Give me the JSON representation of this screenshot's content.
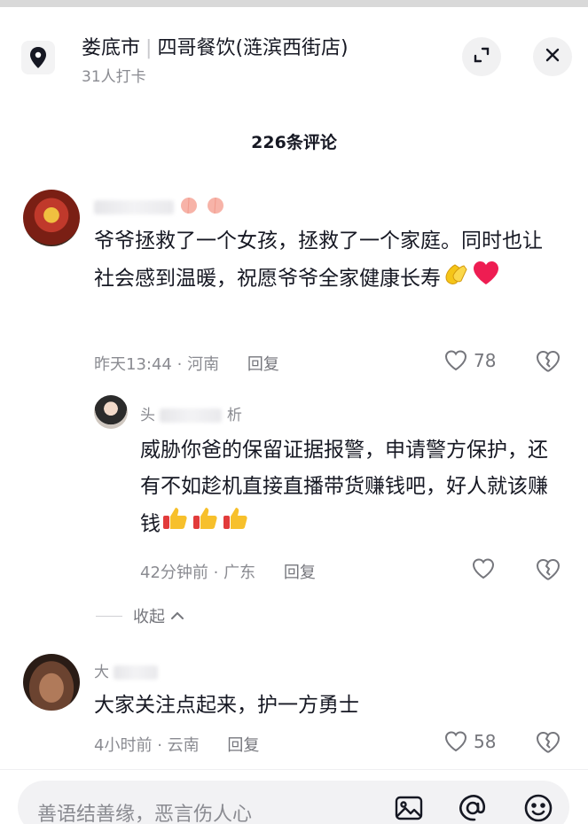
{
  "header": {
    "city": "娄底市",
    "separator": "|",
    "place_name": "四哥餐饮(涟滨西街店)",
    "checkins": "31人打卡",
    "icons": [
      "location-pin-icon",
      "expand-icon",
      "close-icon"
    ]
  },
  "comments_title": "226条评论",
  "comments": [
    {
      "text": "爷爷拯救了一个女孩，拯救了一个家庭。同时也让社会感到温暖，祝愿爷爷全家健康长寿",
      "time": "昨天13:44",
      "dot": "·",
      "region": "河南",
      "reply_label": "回复",
      "likes": "78"
    },
    {
      "username": "头",
      "username_end": "析",
      "text": "威胁你爸的保留证据报警，申请警方保护，还有不如趁机直接直播带货赚钱吧，好人就该赚钱",
      "time": "42分钟前",
      "dot": "·",
      "region": "广东",
      "reply_label": "回复"
    },
    {
      "username": "大",
      "text": "大家关注点起来，护一方勇士",
      "time": "4小时前",
      "dot": "·",
      "region": "云南",
      "reply_label": "回复",
      "likes": "58"
    }
  ],
  "collapse_label": "收起",
  "input": {
    "placeholder": "善语结善缘，恶言伤人心",
    "icons": [
      "image-icon",
      "at-icon",
      "emoji-icon"
    ]
  },
  "colors": {
    "text": "#161823",
    "secondary": "#8a8b91",
    "like_heart": "#ee1d52"
  }
}
